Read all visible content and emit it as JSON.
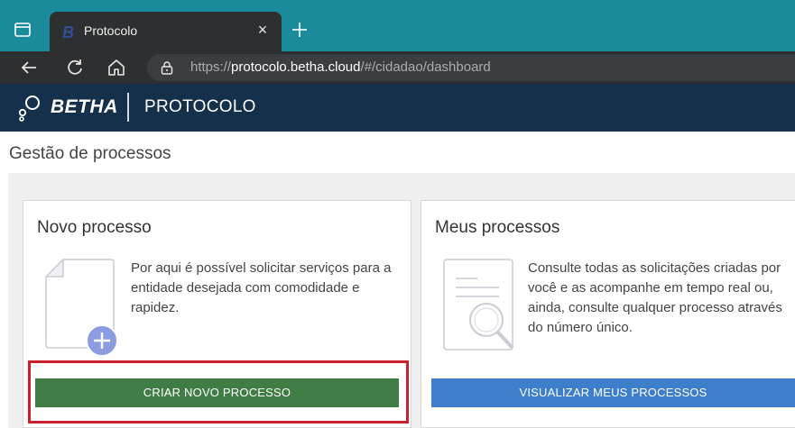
{
  "browser": {
    "tab_title": "Protocolo",
    "tab_close": "×",
    "url_prefix": "https://",
    "url_host": "protocolo.betha.cloud",
    "url_path": "/#/cidadao/dashboard"
  },
  "header": {
    "brand": "BETHA",
    "app_name": "PROTOCOLO"
  },
  "page": {
    "title": "Gestão de processos"
  },
  "cards": [
    {
      "title": "Novo processo",
      "text": "Por aqui é possível solicitar serviços para a entidade desejada com comodidade e rapidez.",
      "button": "CRIAR NOVO PROCESSO",
      "icon": "new-document-icon"
    },
    {
      "title": "Meus processos",
      "text": "Consulte todas as solicitações criadas por você e as acompanhe em tempo real ou, ainda, consulte qualquer processo através do número único.",
      "button": "VISUALIZAR MEUS PROCESSOS",
      "icon": "search-document-icon"
    }
  ],
  "colors": {
    "tab_strip": "#1b8a9b",
    "header": "#14304a",
    "green_button": "#3f7d45",
    "blue_button": "#3d7fcb",
    "highlight": "#c8202d"
  }
}
